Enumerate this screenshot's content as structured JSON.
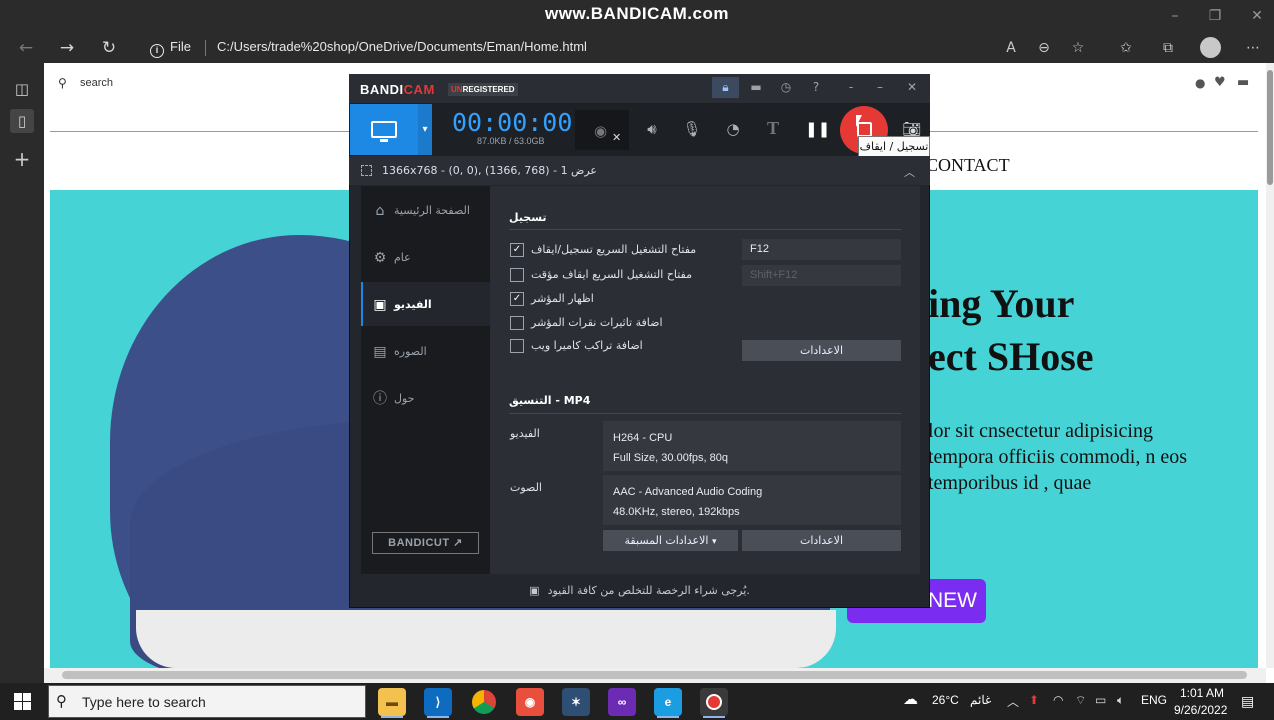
{
  "watermark": "www.BANDICAM.com",
  "browser": {
    "file_label": "File",
    "url": "C:/Users/trade%20shop/OneDrive/Documents/Eman/Home.html"
  },
  "website": {
    "search_placeholder": "search",
    "nav_contact": "CONTACT",
    "heading_line1": "ing Your",
    "heading_line2": "ect SHose",
    "body_text": "lor sit cnsectetur adipisicing tempora officiis commodi, n eos temporibus id , quae",
    "button_label": "NEW",
    "hero_color": "#46d3d6",
    "button_color": "#7b2cf1"
  },
  "bandicam": {
    "logo_bandi": "BANDI",
    "logo_cam": "CAM",
    "unreg_un": "UN",
    "unreg_rest": "REGISTERED",
    "timer": "00:00:00",
    "size": "87.0KB / 63.0GB",
    "tooltip": "تسجيل / ايقاف",
    "region": "1366x768 - (0, 0), (1366, 768) - عرض 1",
    "sidebar": [
      {
        "label": "الصفحة الرئيسية",
        "icon": "home-icon"
      },
      {
        "label": "عام",
        "icon": "gear-icon"
      },
      {
        "label": "الفيديو",
        "icon": "video-icon"
      },
      {
        "label": "الصوره",
        "icon": "image-icon"
      },
      {
        "label": "حول",
        "icon": "info-icon"
      }
    ],
    "bandicut": "BANDICUT ↗",
    "record_section": "تسجيل",
    "options": [
      {
        "label": "مفتاح التشغيل السريع تسجيل/ايقاف",
        "checked": true
      },
      {
        "label": "مفتاح التشغيل السريع ايقاف مؤقت",
        "checked": false
      },
      {
        "label": "اظهار المؤشر",
        "checked": true
      },
      {
        "label": "اضافة تاثيرات نقرات المؤشر",
        "checked": false
      },
      {
        "label": "اضافة تراكب كاميرا ويب",
        "checked": false
      }
    ],
    "hotkey1": "F12",
    "hotkey2": "Shift+F12",
    "settings_button": "الاعدادات",
    "format_section": "التنسيق - MP4",
    "video_label": "الفيديو",
    "video_line1": "H264 - CPU",
    "video_line2": "Full Size, 30.00fps, 80q",
    "audio_label": "الصوت",
    "audio_line1": "AAC - Advanced Audio Coding",
    "audio_line2": "48.0KHz, stereo, 192kbps",
    "presets_button": "الاعدادات المسبقة",
    "settings_button2": "الاعدادات",
    "footer": "يُرجى شراء الرخصة للتخلص من كافة القيود."
  },
  "taskbar": {
    "search_placeholder": "Type here to search",
    "weather": "26°C",
    "weather_text": "غائم",
    "lang": "ENG",
    "time": "1:01 AM",
    "date": "9/26/2022"
  }
}
